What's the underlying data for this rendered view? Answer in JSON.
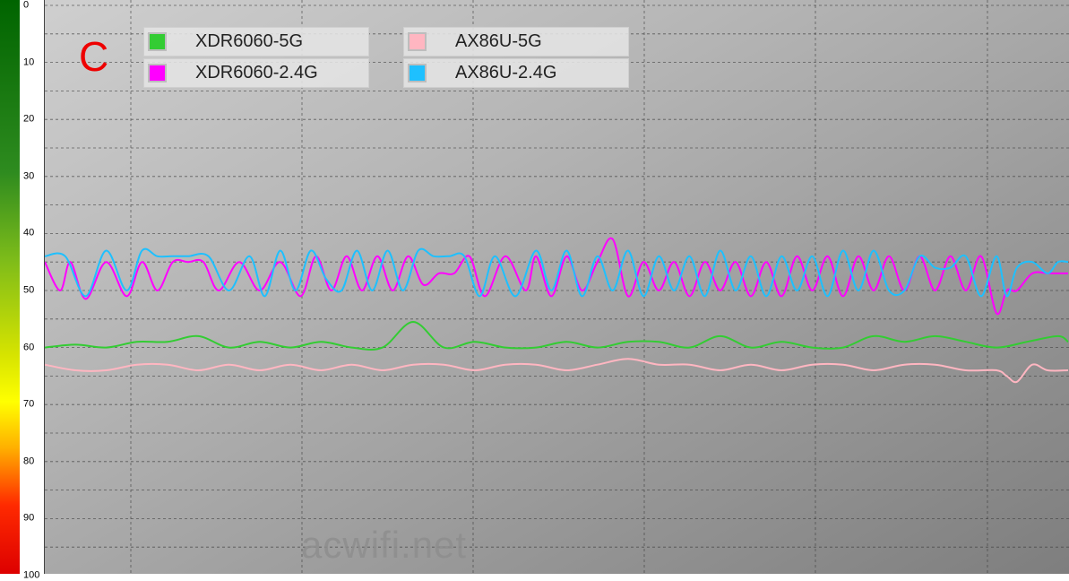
{
  "chart_data": {
    "type": "line",
    "title": "",
    "xlabel": "",
    "ylabel": "",
    "annotation": "C",
    "y_axis": {
      "ticks": [
        0,
        10,
        20,
        30,
        40,
        50,
        60,
        70,
        80,
        90,
        100
      ],
      "reversed": true,
      "ylim": [
        0,
        100
      ]
    },
    "x_range": [
      0,
      100
    ],
    "grid": true,
    "legend_position": "top-left, two columns",
    "series": [
      {
        "name": "XDR6060-5G",
        "color": "#33cc33",
        "x": [
          0,
          3,
          6,
          9,
          12,
          15,
          18,
          21,
          24,
          27,
          30,
          33,
          36,
          39,
          42,
          45,
          48,
          51,
          54,
          57,
          60,
          63,
          66,
          69,
          72,
          75,
          78,
          81,
          84,
          87,
          90,
          93,
          96,
          99,
          100
        ],
        "y": [
          60,
          59.5,
          60,
          59,
          59,
          58,
          60,
          59,
          60,
          59,
          60,
          60,
          55.5,
          60,
          59,
          60,
          60,
          59,
          60,
          59,
          59,
          60,
          58,
          60,
          59,
          60,
          60,
          58,
          59,
          58,
          59,
          60,
          59,
          58,
          59
        ]
      },
      {
        "name": "XDR6060-2.4G",
        "color": "#ff00ff",
        "x": [
          0,
          1.5,
          2.5,
          4,
          6,
          8,
          9.5,
          11,
          12.5,
          14,
          15.5,
          17,
          19,
          21,
          23,
          25,
          26.5,
          28,
          29.5,
          31,
          32.5,
          34,
          35.5,
          37,
          38.5,
          40,
          41.5,
          43,
          45,
          47,
          48,
          49.5,
          51,
          52.5,
          54,
          55.5,
          57,
          58.5,
          60,
          61.5,
          63,
          64.5,
          66,
          67.5,
          69,
          70.5,
          72,
          73.5,
          75,
          76.5,
          78,
          79.5,
          81,
          82.5,
          84,
          85.5,
          87,
          88.5,
          90,
          91.5,
          93,
          94,
          95,
          96.5,
          98,
          99,
          100
        ],
        "y": [
          45,
          50,
          45,
          51.5,
          45,
          51,
          45,
          50,
          45,
          45,
          45,
          50,
          45,
          50,
          45,
          51,
          44,
          50,
          44,
          50,
          44,
          50,
          44,
          49,
          47,
          47,
          44,
          51,
          44,
          50,
          44,
          51,
          44,
          50,
          45,
          41,
          51,
          45,
          50,
          45,
          51,
          45,
          50,
          45,
          51,
          45,
          51,
          44,
          50,
          44,
          51,
          44,
          50,
          44,
          50,
          44,
          50,
          44,
          50,
          44,
          54,
          50,
          50,
          47,
          47,
          47,
          47
        ]
      },
      {
        "name": "AX86U-5G",
        "color": "#ffb6c1",
        "x": [
          0,
          3,
          6,
          9,
          12,
          15,
          18,
          21,
          24,
          27,
          30,
          33,
          36,
          39,
          42,
          45,
          48,
          51,
          54,
          57,
          60,
          63,
          66,
          69,
          72,
          75,
          78,
          81,
          84,
          87,
          90,
          93,
          94,
          95,
          96.5,
          98,
          100
        ],
        "y": [
          63,
          64,
          64,
          63,
          63,
          64,
          63,
          64,
          63,
          64,
          63,
          64,
          63,
          63,
          64,
          63,
          63,
          64,
          63,
          62,
          63,
          63,
          64,
          63,
          64,
          63,
          63,
          64,
          63,
          63,
          64,
          64,
          65,
          66,
          63,
          64,
          64
        ]
      },
      {
        "name": "AX86U-2.4G",
        "color": "#1ec0ff",
        "x": [
          0,
          2,
          4,
          6,
          8,
          9.5,
          11,
          12.5,
          14,
          16,
          18,
          20,
          21.5,
          23,
          24.5,
          26,
          27.5,
          29,
          30.5,
          32,
          33.5,
          35,
          36.5,
          38,
          39.5,
          41,
          42.5,
          44,
          46,
          48,
          49.5,
          51,
          52.5,
          54,
          55.5,
          57,
          58.5,
          60,
          61.5,
          63,
          64.5,
          66,
          67.5,
          69,
          70.5,
          72,
          73.5,
          75,
          76.5,
          78,
          79.5,
          81,
          82.5,
          84,
          85.5,
          87,
          88.5,
          90,
          91.5,
          93,
          94,
          95,
          96.5,
          98,
          99,
          100
        ],
        "y": [
          44,
          44,
          51,
          43,
          50,
          43,
          44,
          44,
          44,
          44,
          50,
          44,
          51,
          43,
          50,
          43,
          48,
          50,
          43,
          50,
          43,
          50,
          43,
          44,
          44,
          44,
          51,
          44,
          51,
          43,
          50,
          43,
          51,
          44,
          50,
          43,
          51,
          44,
          50,
          44,
          51,
          43,
          50,
          44,
          51,
          44,
          50,
          44,
          51,
          43,
          50,
          43,
          50,
          50,
          44,
          46,
          46,
          44,
          51,
          44,
          51,
          46,
          45,
          47,
          45,
          45
        ]
      }
    ]
  },
  "watermark": "acwifi.net"
}
